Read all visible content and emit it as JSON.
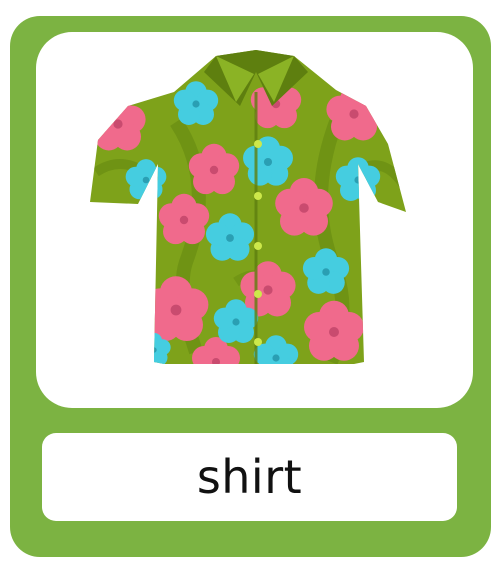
{
  "card": {
    "word": "shirt",
    "illustration": "hawaiian-shirt-illustration",
    "colors": {
      "frame": "#7cb342",
      "panel": "#ffffff",
      "shirt_base": "#7ea21a",
      "shirt_dark": "#5e7f0f",
      "flower_pink": "#f06a8c",
      "flower_blue": "#45cde0",
      "button": "#cde84a"
    }
  }
}
